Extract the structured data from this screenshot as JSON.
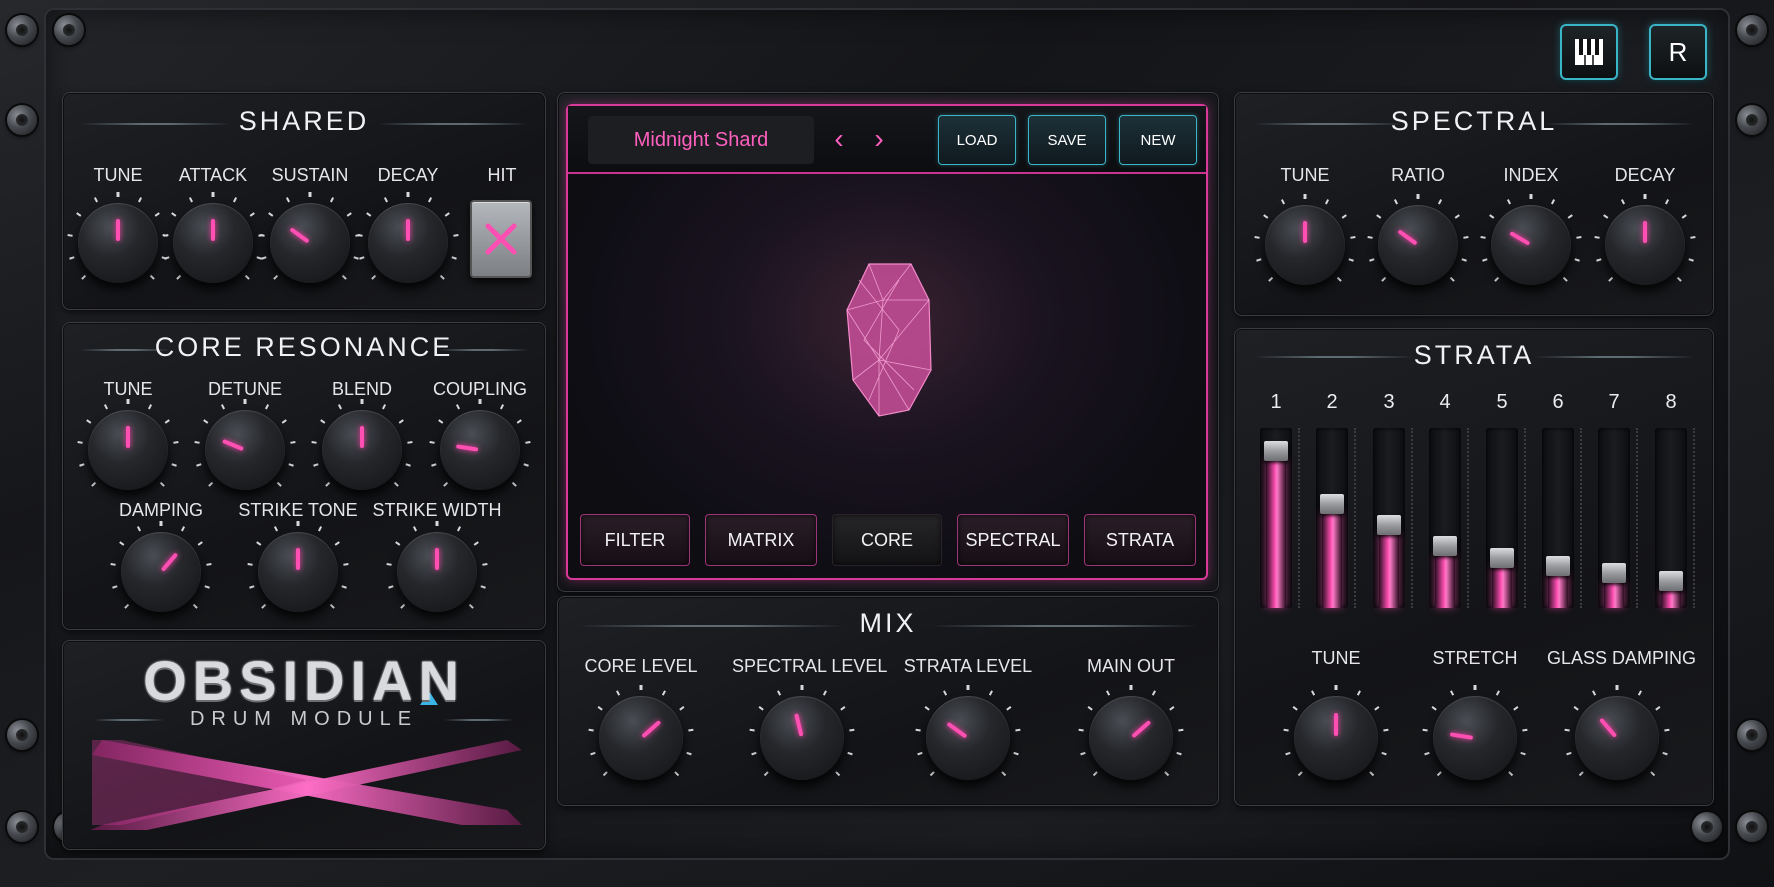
{
  "top_buttons": {
    "keyboard_icon": "piano-keys-icon",
    "r_label": "R"
  },
  "shared": {
    "title": "SHARED",
    "knobs": [
      {
        "label": "TUNE",
        "value": 0.5
      },
      {
        "label": "ATTACK",
        "value": 0.5
      },
      {
        "label": "SUSTAIN",
        "value": 0.3
      },
      {
        "label": "DECAY",
        "value": 0.5
      }
    ],
    "hit_label": "HIT"
  },
  "core": {
    "title": "CORE RESONANCE",
    "knobs": [
      {
        "label": "TUNE",
        "value": 0.5
      },
      {
        "label": "DETUNE",
        "value": 0.25
      },
      {
        "label": "BLEND",
        "value": 0.5
      },
      {
        "label": "COUPLING",
        "value": 0.2
      },
      {
        "label": "DAMPING",
        "value": 0.65
      },
      {
        "label": "STRIKE TONE",
        "value": 0.5
      },
      {
        "label": "STRIKE WIDTH",
        "value": 0.5
      }
    ]
  },
  "logo": {
    "name": "OBSIDIAN",
    "sub": "DRUM MODULE"
  },
  "display": {
    "preset_name": "Midnight Shard",
    "load": "LOAD",
    "save": "SAVE",
    "new": "NEW",
    "tabs": [
      "FILTER",
      "MATRIX",
      "CORE",
      "SPECTRAL",
      "STRATA"
    ],
    "active_tab": "CORE"
  },
  "mix": {
    "title": "MIX",
    "knobs": [
      {
        "label": "CORE LEVEL",
        "value": 0.68
      },
      {
        "label": "SPECTRAL LEVEL",
        "value": 0.45
      },
      {
        "label": "STRATA LEVEL",
        "value": 0.3
      },
      {
        "label": "MAIN OUT",
        "value": 0.68
      }
    ]
  },
  "spectral": {
    "title": "SPECTRAL",
    "knobs": [
      {
        "label": "TUNE",
        "value": 0.5
      },
      {
        "label": "RATIO",
        "value": 0.3
      },
      {
        "label": "INDEX",
        "value": 0.28
      },
      {
        "label": "DECAY",
        "value": 0.5
      }
    ]
  },
  "strata": {
    "title": "STRATA",
    "bands": [
      "1",
      "2",
      "3",
      "4",
      "5",
      "6",
      "7",
      "8"
    ],
    "levels": [
      0.93,
      0.6,
      0.47,
      0.34,
      0.26,
      0.21,
      0.17,
      0.12
    ],
    "knobs": [
      {
        "label": "TUNE",
        "value": 0.5
      },
      {
        "label": "STRETCH",
        "value": 0.2
      },
      {
        "label": "GLASS DAMPING",
        "value": 0.35
      }
    ]
  },
  "colors": {
    "accent": "#ff4fb3",
    "cyan": "#3ab5c7",
    "panel": "#17181b"
  }
}
